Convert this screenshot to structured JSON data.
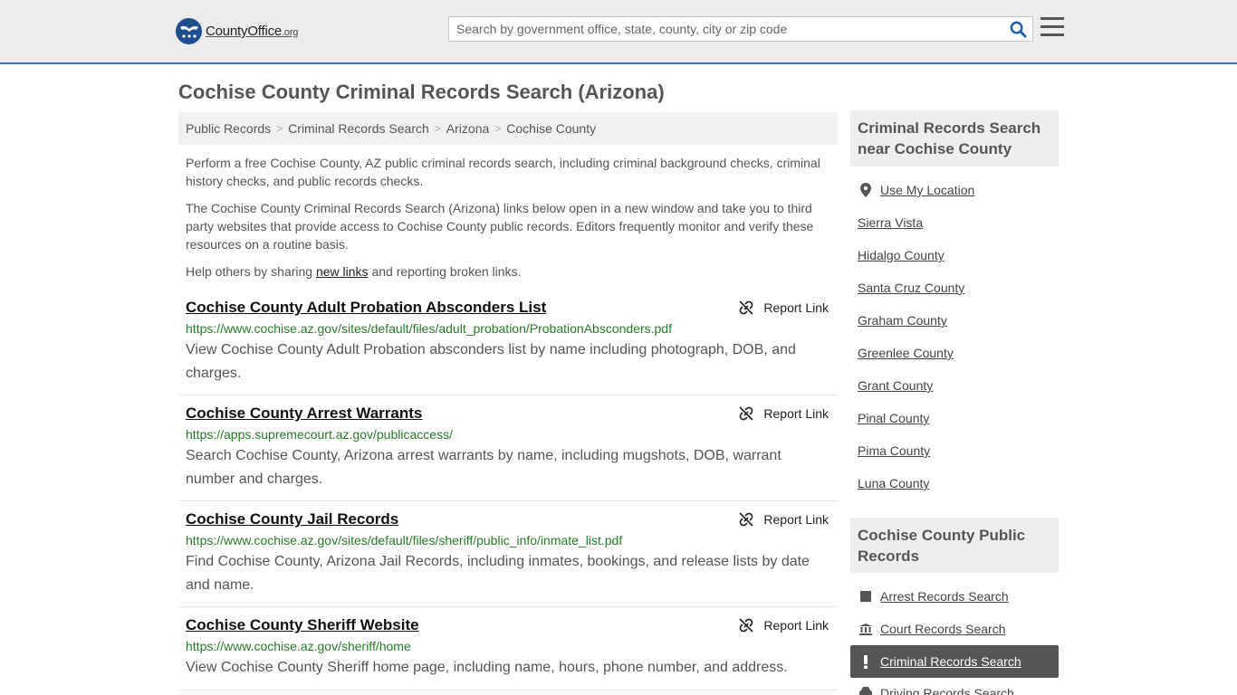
{
  "header": {
    "logo_main": "CountyOffice",
    "logo_suffix": ".org",
    "search_placeholder": "Search by government office, state, county, city or zip code"
  },
  "page": {
    "title": "Cochise County Criminal Records Search (Arizona)"
  },
  "breadcrumb": [
    "Public Records",
    "Criminal Records Search",
    "Arizona",
    "Cochise County"
  ],
  "intro": {
    "p1": "Perform a free Cochise County, AZ public criminal records search, including criminal background checks, criminal history checks, and public records checks.",
    "p2": "The Cochise County Criminal Records Search (Arizona) links below open in a new window and take you to third party websites that provide access to Cochise County public records. Editors frequently monitor and verify these resources on a routine basis.",
    "p3_before": "Help others by sharing ",
    "p3_link": "new links",
    "p3_after": " and reporting broken links."
  },
  "report_label": "Report Link",
  "results": [
    {
      "title": "Cochise County Adult Probation Absconders List",
      "url": "https://www.cochise.az.gov/sites/default/files/adult_probation/ProbationAbsconders.pdf",
      "desc": "View Cochise County Adult Probation absconders list by name including photograph, DOB, and charges."
    },
    {
      "title": "Cochise County Arrest Warrants",
      "url": "https://apps.supremecourt.az.gov/publicaccess/",
      "desc": "Search Cochise County, Arizona arrest warrants by name, including mugshots, DOB, warrant number and charges."
    },
    {
      "title": "Cochise County Jail Records",
      "url": "https://www.cochise.az.gov/sites/default/files/sheriff/public_info/inmate_list.pdf",
      "desc": "Find Cochise County, Arizona Jail Records, including inmates, bookings, and release lists by date and name."
    },
    {
      "title": "Cochise County Sheriff Website",
      "url": "https://www.cochise.az.gov/sheriff/home",
      "desc": "View Cochise County Sheriff home page, including name, hours, phone number, and address."
    }
  ],
  "sidebar": {
    "nearby_title": "Criminal Records Search near Cochise County",
    "use_location": "Use My Location",
    "nearby": [
      "Sierra Vista",
      "Hidalgo County",
      "Santa Cruz County",
      "Graham County",
      "Greenlee County",
      "Grant County",
      "Pinal County",
      "Pima County",
      "Luna County"
    ],
    "public_title": "Cochise County Public Records",
    "public": [
      {
        "label": "Arrest Records Search",
        "icon": "square-icon"
      },
      {
        "label": "Court Records Search",
        "icon": "courthouse-icon"
      },
      {
        "label": "Criminal Records Search",
        "icon": "exclamation-icon",
        "active": true
      },
      {
        "label": "Driving Records Search",
        "icon": "car-icon"
      }
    ]
  },
  "colors": {
    "accent": "#3c78b5",
    "url_green": "#2a7a2a",
    "logo_blue": "#1d4f91"
  }
}
